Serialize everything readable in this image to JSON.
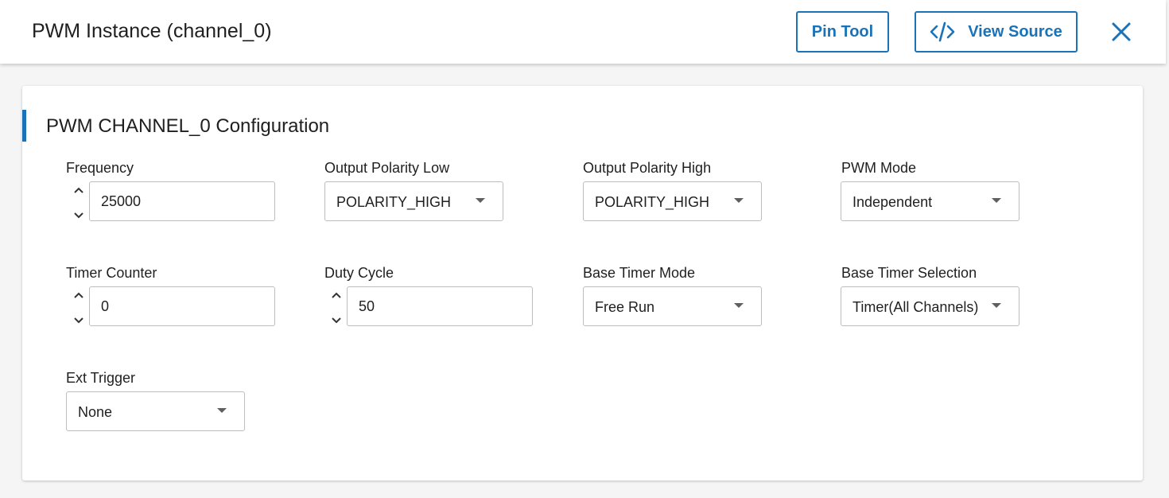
{
  "header": {
    "title": "PWM Instance (channel_0)",
    "pin_tool_label": "Pin Tool",
    "view_source_label": "View Source",
    "accent_color": "#1a73b8"
  },
  "card": {
    "title": "PWM CHANNEL_0 Configuration",
    "fields": {
      "frequency": {
        "label": "Frequency",
        "value": "25000"
      },
      "output_polarity_low": {
        "label": "Output Polarity Low",
        "value": "POLARITY_HIGH"
      },
      "output_polarity_high": {
        "label": "Output Polarity High",
        "value": "POLARITY_HIGH"
      },
      "pwm_mode": {
        "label": "PWM Mode",
        "value": "Independent"
      },
      "timer_counter": {
        "label": "Timer Counter",
        "value": "0"
      },
      "duty_cycle": {
        "label": "Duty Cycle",
        "value": "50"
      },
      "base_timer_mode": {
        "label": "Base Timer Mode",
        "value": "Free Run"
      },
      "base_timer_selection": {
        "label": "Base Timer Selection",
        "value": "Timer(All Channels)"
      },
      "ext_trigger": {
        "label": "Ext Trigger",
        "value": "None"
      }
    }
  },
  "icons": {
    "code": "code-icon",
    "close": "close-icon",
    "step_up": "chevron-up-icon",
    "step_down": "chevron-down-icon",
    "dropdown": "caret-down-icon"
  }
}
